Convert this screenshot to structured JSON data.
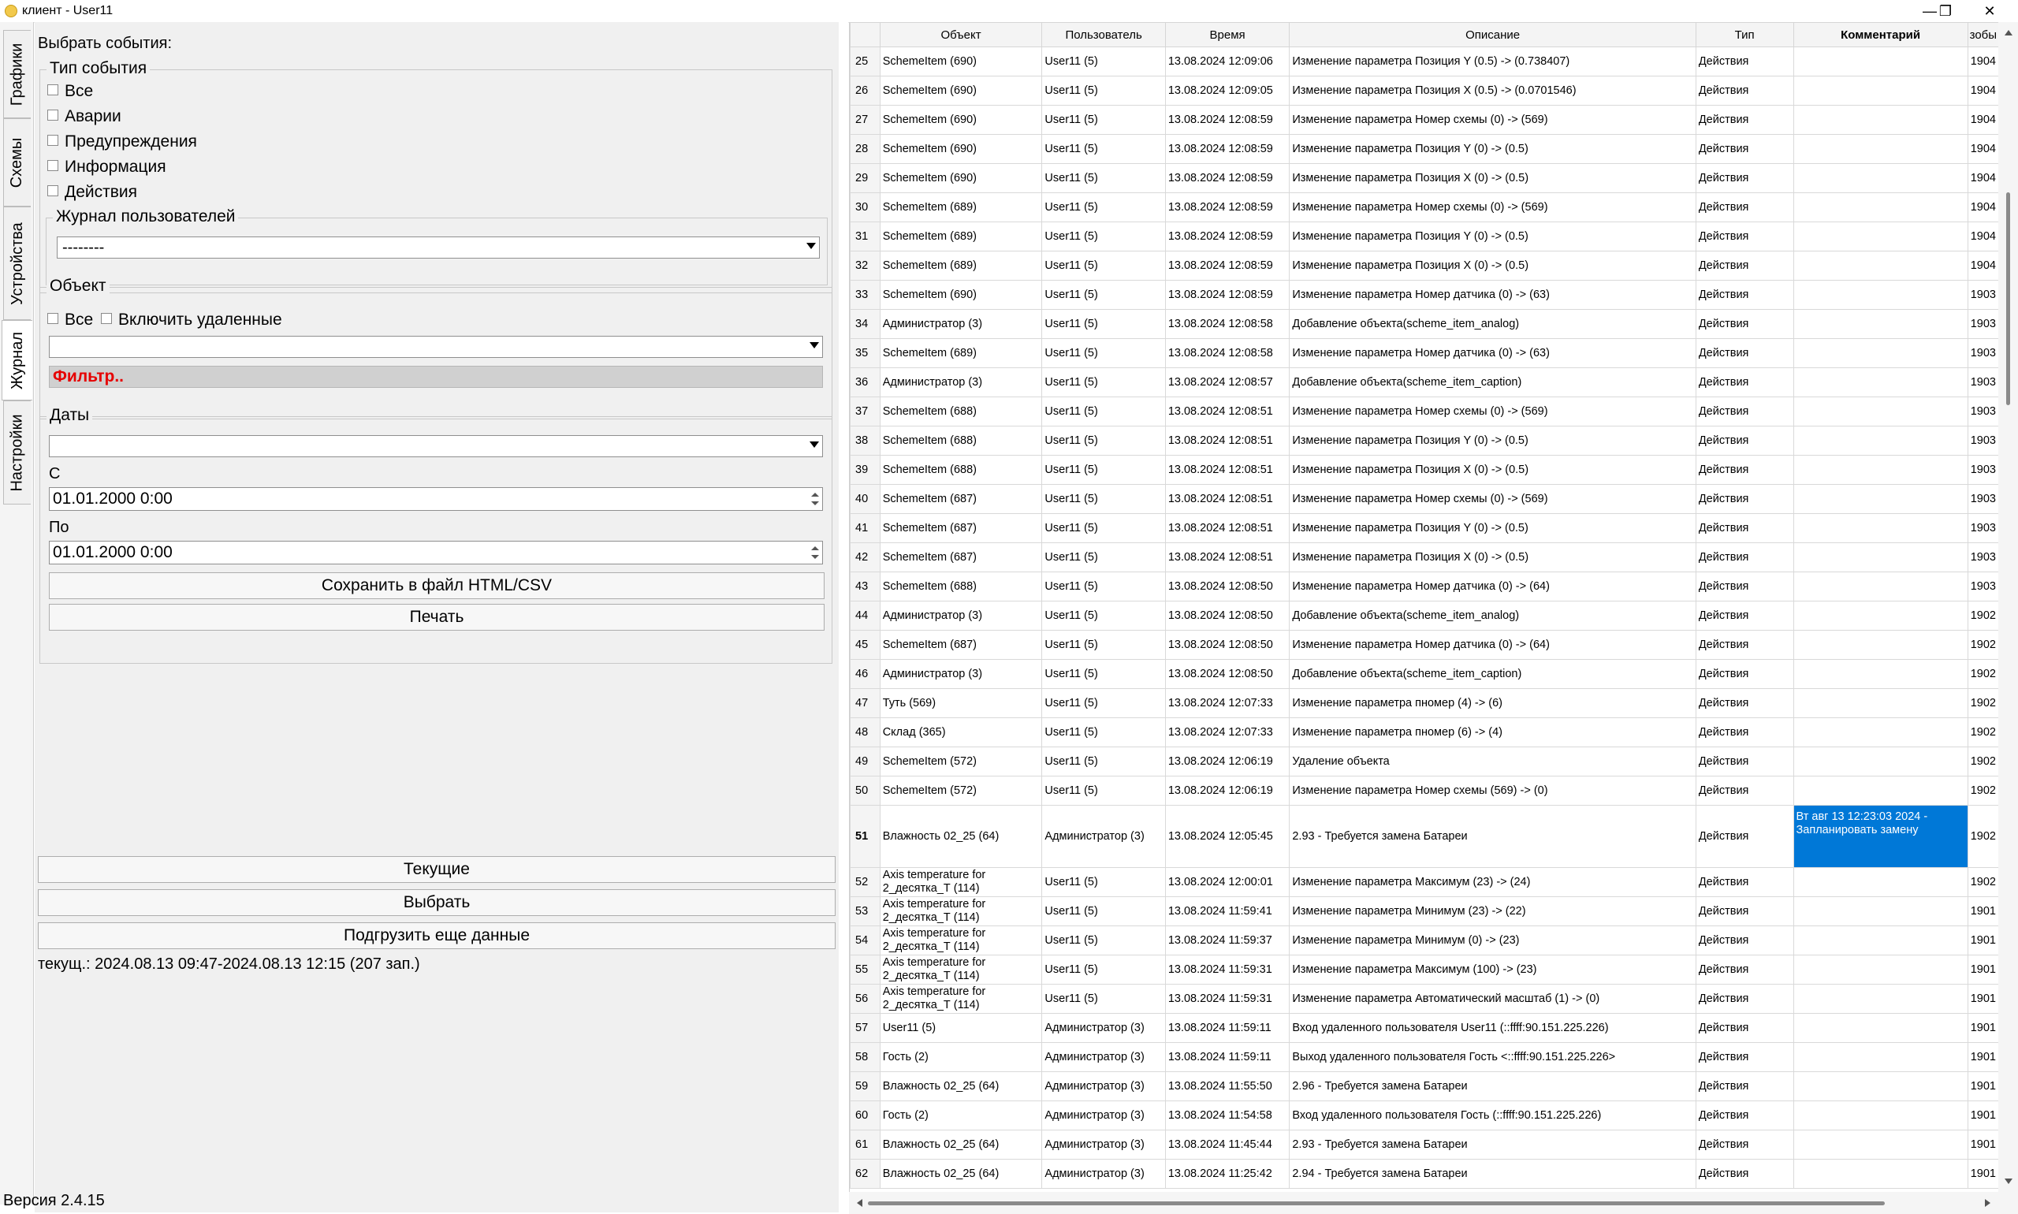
{
  "window": {
    "title": "клиент - User11",
    "min": "—",
    "max": "❐",
    "close": "✕"
  },
  "tabs": [
    "Графики",
    "Схемы",
    "Устройства",
    "Журнал",
    "Настройки"
  ],
  "filter": {
    "choose_events": "Выбрать события:",
    "event_type": "Тип события",
    "types": [
      "Все",
      "Аварии",
      "Предупреждения",
      "Информация",
      "Действия"
    ],
    "user_log": "Журнал пользователей",
    "user_log_value": "--------",
    "object": "Объект",
    "obj_all": "Все",
    "obj_include_deleted": "Включить удаленные",
    "obj_value": "",
    "filter_link": "Фильтр..",
    "dates": "Даты",
    "dates_value": "",
    "from_label": "С",
    "from_value": "01.01.2000 0:00",
    "to_label": "По",
    "to_value": "01.01.2000 0:00",
    "save_button": "Сохранить в файл HTML/CSV",
    "print_button": "Печать",
    "current_button": "Текущие",
    "select_button": "Выбрать",
    "load_more_button": "Подгрузить еще данные",
    "status": "текущ.: 2024.08.13 09:47-2024.08.13 12:15 (207 зап.)",
    "version": "Версия 2.4.15"
  },
  "grid": {
    "columns": [
      "",
      "Объект",
      "Пользователь",
      "Время",
      "Описание",
      "Тип",
      "Комментарий",
      "зобы"
    ],
    "rows": [
      [
        "25",
        "SchemeItem (690)",
        "User11 (5)",
        "13.08.2024 12:09:06",
        "Изменение параметра Позиция Y (0.5) -> (0.738407)",
        "Действия",
        "",
        "1904"
      ],
      [
        "26",
        "SchemeItem (690)",
        "User11 (5)",
        "13.08.2024 12:09:05",
        "Изменение параметра Позиция X (0.5) -> (0.0701546)",
        "Действия",
        "",
        "1904"
      ],
      [
        "27",
        "SchemeItem (690)",
        "User11 (5)",
        "13.08.2024 12:08:59",
        "Изменение параметра Номер схемы (0) -> (569)",
        "Действия",
        "",
        "1904"
      ],
      [
        "28",
        "SchemeItem (690)",
        "User11 (5)",
        "13.08.2024 12:08:59",
        "Изменение параметра Позиция Y (0) -> (0.5)",
        "Действия",
        "",
        "1904"
      ],
      [
        "29",
        "SchemeItem (690)",
        "User11 (5)",
        "13.08.2024 12:08:59",
        "Изменение параметра Позиция X (0) -> (0.5)",
        "Действия",
        "",
        "1904"
      ],
      [
        "30",
        "SchemeItem (689)",
        "User11 (5)",
        "13.08.2024 12:08:59",
        "Изменение параметра Номер схемы (0) -> (569)",
        "Действия",
        "",
        "1904"
      ],
      [
        "31",
        "SchemeItem (689)",
        "User11 (5)",
        "13.08.2024 12:08:59",
        "Изменение параметра Позиция Y (0) -> (0.5)",
        "Действия",
        "",
        "1904"
      ],
      [
        "32",
        "SchemeItem (689)",
        "User11 (5)",
        "13.08.2024 12:08:59",
        "Изменение параметра Позиция X (0) -> (0.5)",
        "Действия",
        "",
        "1904"
      ],
      [
        "33",
        "SchemeItem (690)",
        "User11 (5)",
        "13.08.2024 12:08:59",
        "Изменение параметра Номер датчика (0) -> (63)",
        "Действия",
        "",
        "1903"
      ],
      [
        "34",
        "Администратор (3)",
        "User11 (5)",
        "13.08.2024 12:08:58",
        "Добавление объекта(scheme_item_analog)",
        "Действия",
        "",
        "1903"
      ],
      [
        "35",
        "SchemeItem (689)",
        "User11 (5)",
        "13.08.2024 12:08:58",
        "Изменение параметра Номер датчика (0) -> (63)",
        "Действия",
        "",
        "1903"
      ],
      [
        "36",
        "Администратор (3)",
        "User11 (5)",
        "13.08.2024 12:08:57",
        "Добавление объекта(scheme_item_caption)",
        "Действия",
        "",
        "1903"
      ],
      [
        "37",
        "SchemeItem (688)",
        "User11 (5)",
        "13.08.2024 12:08:51",
        "Изменение параметра Номер схемы (0) -> (569)",
        "Действия",
        "",
        "1903"
      ],
      [
        "38",
        "SchemeItem (688)",
        "User11 (5)",
        "13.08.2024 12:08:51",
        "Изменение параметра Позиция Y (0) -> (0.5)",
        "Действия",
        "",
        "1903"
      ],
      [
        "39",
        "SchemeItem (688)",
        "User11 (5)",
        "13.08.2024 12:08:51",
        "Изменение параметра Позиция X (0) -> (0.5)",
        "Действия",
        "",
        "1903"
      ],
      [
        "40",
        "SchemeItem (687)",
        "User11 (5)",
        "13.08.2024 12:08:51",
        "Изменение параметра Номер схемы (0) -> (569)",
        "Действия",
        "",
        "1903"
      ],
      [
        "41",
        "SchemeItem (687)",
        "User11 (5)",
        "13.08.2024 12:08:51",
        "Изменение параметра Позиция Y (0) -> (0.5)",
        "Действия",
        "",
        "1903"
      ],
      [
        "42",
        "SchemeItem (687)",
        "User11 (5)",
        "13.08.2024 12:08:51",
        "Изменение параметра Позиция X (0) -> (0.5)",
        "Действия",
        "",
        "1903"
      ],
      [
        "43",
        "SchemeItem (688)",
        "User11 (5)",
        "13.08.2024 12:08:50",
        "Изменение параметра Номер датчика (0) -> (64)",
        "Действия",
        "",
        "1903"
      ],
      [
        "44",
        "Администратор (3)",
        "User11 (5)",
        "13.08.2024 12:08:50",
        "Добавление объекта(scheme_item_analog)",
        "Действия",
        "",
        "1902"
      ],
      [
        "45",
        "SchemeItem (687)",
        "User11 (5)",
        "13.08.2024 12:08:50",
        "Изменение параметра Номер датчика (0) -> (64)",
        "Действия",
        "",
        "1902"
      ],
      [
        "46",
        "Администратор (3)",
        "User11 (5)",
        "13.08.2024 12:08:50",
        "Добавление объекта(scheme_item_caption)",
        "Действия",
        "",
        "1902"
      ],
      [
        "47",
        "Туть (569)",
        "User11 (5)",
        "13.08.2024 12:07:33",
        "Изменение параметра пномер (4) -> (6)",
        "Действия",
        "",
        "1902"
      ],
      [
        "48",
        "Склад (365)",
        "User11 (5)",
        "13.08.2024 12:07:33",
        "Изменение параметра пномер (6) -> (4)",
        "Действия",
        "",
        "1902"
      ],
      [
        "49",
        "SchemeItem (572)",
        "User11 (5)",
        "13.08.2024 12:06:19",
        "Удаление объекта",
        "Действия",
        "",
        "1902"
      ],
      [
        "50",
        "SchemeItem (572)",
        "User11 (5)",
        "13.08.2024 12:06:19",
        "Изменение параметра Номер схемы (569) -> (0)",
        "Действия",
        "",
        "1902"
      ],
      [
        "51",
        "Влажность 02_25 (64)",
        "Администратор (3)",
        "13.08.2024 12:05:45",
        "2.93 - Требуется замена Батареи",
        "Действия",
        "Вт авг 13 12:23:03 2024 - Запланировать замену",
        "1902"
      ],
      [
        "52",
        "Axis temperature for 2_десятка_Т (114)",
        "User11 (5)",
        "13.08.2024 12:00:01",
        "Изменение параметра Максимум (23) -> (24)",
        "Действия",
        "",
        "1902"
      ],
      [
        "53",
        "Axis temperature for 2_десятка_Т (114)",
        "User11 (5)",
        "13.08.2024 11:59:41",
        "Изменение параметра Минимум (23) -> (22)",
        "Действия",
        "",
        "1901"
      ],
      [
        "54",
        "Axis temperature for 2_десятка_Т (114)",
        "User11 (5)",
        "13.08.2024 11:59:37",
        "Изменение параметра Минимум (0) -> (23)",
        "Действия",
        "",
        "1901"
      ],
      [
        "55",
        "Axis temperature for 2_десятка_Т (114)",
        "User11 (5)",
        "13.08.2024 11:59:31",
        "Изменение параметра Максимум (100) -> (23)",
        "Действия",
        "",
        "1901"
      ],
      [
        "56",
        "Axis temperature for 2_десятка_Т (114)",
        "User11 (5)",
        "13.08.2024 11:59:31",
        "Изменение параметра Автоматический масштаб (1) -> (0)",
        "Действия",
        "",
        "1901"
      ],
      [
        "57",
        "User11 (5)",
        "Администратор (3)",
        "13.08.2024 11:59:11",
        "Вход удаленного пользователя User11 (::ffff:90.151.225.226)",
        "Действия",
        "",
        "1901"
      ],
      [
        "58",
        "Гость (2)",
        "Администратор (3)",
        "13.08.2024 11:59:11",
        "Выход удаленного пользователя Гость <::ffff:90.151.225.226>",
        "Действия",
        "",
        "1901"
      ],
      [
        "59",
        "Влажность 02_25 (64)",
        "Администратор (3)",
        "13.08.2024 11:55:50",
        "2.96 - Требуется замена Батареи",
        "Действия",
        "",
        "1901"
      ],
      [
        "60",
        "Гость (2)",
        "Администратор (3)",
        "13.08.2024 11:54:58",
        "Вход удаленного пользователя Гость (::ffff:90.151.225.226)",
        "Действия",
        "",
        "1901"
      ],
      [
        "61",
        "Влажность 02_25 (64)",
        "Администратор (3)",
        "13.08.2024 11:45:44",
        "2.93 - Требуется замена Батареи",
        "Действия",
        "",
        "1901"
      ],
      [
        "62",
        "Влажность 02_25 (64)",
        "Администратор (3)",
        "13.08.2024 11:25:42",
        "2.94 - Требуется замена Батареи",
        "Действия",
        "",
        "1901"
      ]
    ]
  }
}
